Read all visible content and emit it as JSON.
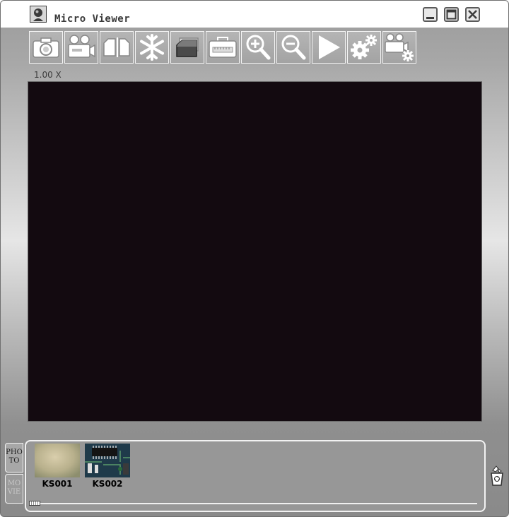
{
  "window": {
    "title": "Micro Viewer"
  },
  "titlebar_buttons": [
    "minimize-icon",
    "maximize-icon",
    "close-icon"
  ],
  "toolbar": {
    "tools": [
      {
        "name": "capture-photo",
        "icon": "camera-icon"
      },
      {
        "name": "record-video",
        "icon": "video-camera-icon"
      },
      {
        "name": "compare",
        "icon": "split-pages-icon"
      },
      {
        "name": "freeze",
        "icon": "snowflake-icon"
      },
      {
        "name": "overlay",
        "icon": "layers-icon"
      },
      {
        "name": "measure",
        "icon": "toolbox-ruler-icon"
      },
      {
        "name": "zoom-in",
        "icon": "zoom-in-icon"
      },
      {
        "name": "zoom-out",
        "icon": "zoom-out-icon"
      },
      {
        "name": "play",
        "icon": "play-icon"
      },
      {
        "name": "settings",
        "icon": "gears-icon"
      },
      {
        "name": "camera-settings",
        "icon": "video-camera-gear-icon"
      }
    ]
  },
  "zoom_label": "1.00 X",
  "viewer": {
    "background": "#130a10"
  },
  "tabs": {
    "photo": [
      "PHO",
      "TO"
    ],
    "movie": [
      "MO",
      "VIE"
    ]
  },
  "gallery": {
    "items": [
      {
        "label": "KS001",
        "icon": "blurry-photo-thumbnail"
      },
      {
        "label": "KS002",
        "icon": "circuit-board-thumbnail"
      }
    ],
    "scroll_position": 0
  },
  "trash": {
    "icon": "recycle-bin-icon"
  }
}
